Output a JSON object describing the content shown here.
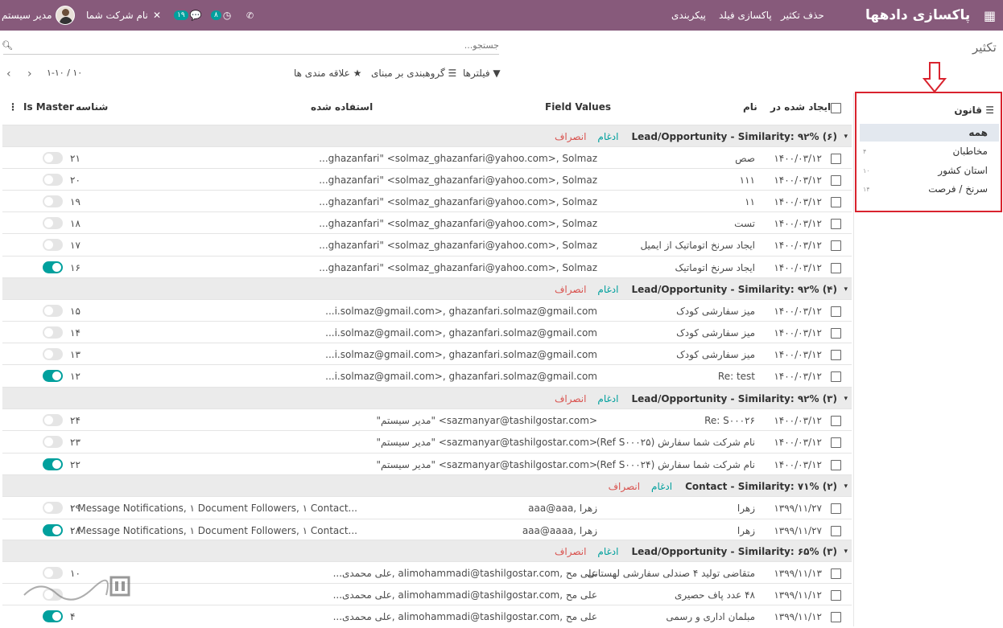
{
  "topbar": {
    "apps_icon": "grid-icon",
    "app_title": "پاکسازی دادهها",
    "menu": [
      "حذف تکثیر",
      "پاکسازی فیلد",
      "پیکربندی"
    ],
    "user": "مدیر سیستم",
    "company": "نام شرکت شما",
    "chat_badge": "۱۹",
    "activity_badge": "۸"
  },
  "breadcrumb": "تکثیر",
  "search": {
    "placeholder": "جستجو...",
    "icon": "search-icon"
  },
  "controls": {
    "filters": "فیلترها",
    "groupby": "گروهبندی بر مبنای",
    "favorites": "علاقه مندی ها",
    "pager": "۱-۱۰ / ۱۰"
  },
  "sidebar": {
    "title": "قانون",
    "items": [
      {
        "label": "همه",
        "count": ""
      },
      {
        "label": "مخاطبان",
        "count": "۴"
      },
      {
        "label": "استان کشور",
        "count": "۱۰"
      },
      {
        "label": "سرنخ / فرصت",
        "count": "۱۴"
      }
    ]
  },
  "columns": {
    "created": "ایجاد شده در",
    "name": "نام",
    "field_values": "Field Values",
    "used": "استفاده شده",
    "id": "شناسه",
    "is_master": "Is Master"
  },
  "groups": [
    {
      "title": "Lead/Opportunity - Similarity: ۹۲% (۶)",
      "merge": "ادغام",
      "dismiss": "انصراف",
      "rows": [
        {
          "date": "۱۴۰۰/۰۳/۱۲",
          "name": "صص",
          "values": "...ghazanfari\" <solmaz_ghazanfari@yahoo.com>, Solmaz",
          "used": "",
          "id": "۲۱",
          "master": false
        },
        {
          "date": "۱۴۰۰/۰۳/۱۲",
          "name": "۱۱۱",
          "values": "...ghazanfari\" <solmaz_ghazanfari@yahoo.com>, Solmaz",
          "used": "",
          "id": "۲۰",
          "master": false
        },
        {
          "date": "۱۴۰۰/۰۳/۱۲",
          "name": "۱۱",
          "values": "...ghazanfari\" <solmaz_ghazanfari@yahoo.com>, Solmaz",
          "used": "",
          "id": "۱۹",
          "master": false
        },
        {
          "date": "۱۴۰۰/۰۳/۱۲",
          "name": "تست",
          "values": "...ghazanfari\" <solmaz_ghazanfari@yahoo.com>, Solmaz",
          "used": "",
          "id": "۱۸",
          "master": false
        },
        {
          "date": "۱۴۰۰/۰۳/۱۲",
          "name": "ایجاد سرنخ اتوماتیک از ایمیل",
          "values": "...ghazanfari\" <solmaz_ghazanfari@yahoo.com>, Solmaz",
          "used": "",
          "id": "۱۷",
          "master": false
        },
        {
          "date": "۱۴۰۰/۰۳/۱۲",
          "name": "ایجاد سرنخ اتوماتیک",
          "values": "...ghazanfari\" <solmaz_ghazanfari@yahoo.com>, Solmaz",
          "used": "",
          "id": "۱۶",
          "master": true
        }
      ]
    },
    {
      "title": "Lead/Opportunity - Similarity: ۹۲% (۴)",
      "merge": "ادغام",
      "dismiss": "انصراف",
      "rows": [
        {
          "date": "۱۴۰۰/۰۳/۱۲",
          "name": "میز سفارشی کودک",
          "values": "...i.solmaz@gmail.com>, ghazanfari.solmaz@gmail.com",
          "used": "",
          "id": "۱۵",
          "master": false
        },
        {
          "date": "۱۴۰۰/۰۳/۱۲",
          "name": "میز سفارشی کودک",
          "values": "...i.solmaz@gmail.com>, ghazanfari.solmaz@gmail.com",
          "used": "",
          "id": "۱۴",
          "master": false
        },
        {
          "date": "۱۴۰۰/۰۳/۱۲",
          "name": "میز سفارشی کودک",
          "values": "...i.solmaz@gmail.com>, ghazanfari.solmaz@gmail.com",
          "used": "",
          "id": "۱۳",
          "master": false
        },
        {
          "date": "۱۴۰۰/۰۳/۱۲",
          "name": "Re: test",
          "values": "...i.solmaz@gmail.com>, ghazanfari.solmaz@gmail.com",
          "used": "",
          "id": "۱۲",
          "master": true
        }
      ]
    },
    {
      "title": "Lead/Opportunity - Similarity: ۹۲% (۳)",
      "merge": "ادغام",
      "dismiss": "انصراف",
      "rows": [
        {
          "date": "۱۴۰۰/۰۳/۱۲",
          "name": "Re: S۰۰۰۲۶",
          "values": "\"مدیر سیستم\" <sazmanyar@tashilgostar.com>",
          "used": "",
          "id": "۲۴",
          "master": false
        },
        {
          "date": "۱۴۰۰/۰۳/۱۲",
          "name": "نام شرکت شما سفارش (Ref S۰۰۰۲۵)",
          "values": "\"مدیر سیستم\" <sazmanyar@tashilgostar.com>",
          "used": "",
          "id": "۲۳",
          "master": false
        },
        {
          "date": "۱۴۰۰/۰۳/۱۲",
          "name": "نام شرکت شما سفارش (Ref S۰۰۰۲۴)",
          "values": "\"مدیر سیستم\" <sazmanyar@tashilgostar.com>",
          "used": "",
          "id": "۲۲",
          "master": true
        }
      ]
    },
    {
      "title": "Contact - Similarity: ۷۱% (۲)",
      "merge": "ادغام",
      "dismiss": "انصراف",
      "rows": [
        {
          "date": "۱۳۹۹/۱۱/۲۷",
          "name": "زهرا",
          "values": "aaa@aaa, زهرا",
          "used": "۱ Message Notifications, ۱ Document Followers, ۱ Contact...",
          "id": "۲۹",
          "master": false
        },
        {
          "date": "۱۳۹۹/۱۱/۲۷",
          "name": "زهرا",
          "values": "aaa@aaaa, زهرا",
          "used": "۱ Message Notifications, ۱ Document Followers, ۱ Contact...",
          "id": "۲۸",
          "master": true
        }
      ]
    },
    {
      "title": "Lead/Opportunity - Similarity: ۶۵% (۳)",
      "merge": "ادغام",
      "dismiss": "انصراف",
      "rows": [
        {
          "date": "۱۳۹۹/۱۱/۱۳",
          "name": "متقاضی تولید ۴ صندلی سفارشی لهستانی",
          "values": "...علی محمدی, alimohammadi@tashilgostar.com, علی مح",
          "used": "",
          "id": "۱۰",
          "master": false
        },
        {
          "date": "۱۳۹۹/۱۱/۱۲",
          "name": "۴۸ عدد پاف حصیری",
          "values": "...علی محمدی, alimohammadi@tashilgostar.com, علی مح",
          "used": "",
          "id": "",
          "master": false
        },
        {
          "date": "۱۳۹۹/۱۱/۱۲",
          "name": "مبلمان اداری و رسمی",
          "values": "...علی محمدی, alimohammadi@tashilgostar.com, علی مح",
          "used": "",
          "id": "۴",
          "master": true
        }
      ]
    }
  ]
}
